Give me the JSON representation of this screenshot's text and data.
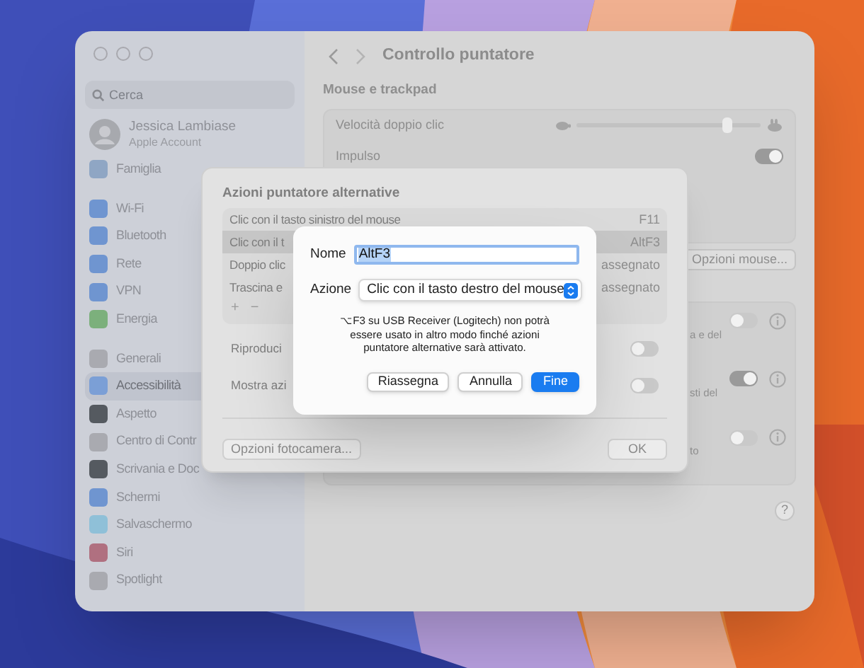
{
  "sidebar": {
    "search": {
      "placeholder": "Cerca"
    },
    "account": {
      "name": "Jessica Lambiase",
      "subtitle": "Apple Account"
    },
    "groups": [
      [
        {
          "label": "Famiglia",
          "color": "#8fa6c4",
          "selected": false
        }
      ],
      [
        {
          "label": "Wi-Fi",
          "color": "#6f95d0",
          "selected": false
        },
        {
          "label": "Bluetooth",
          "color": "#6f95d0",
          "selected": false
        },
        {
          "label": "Rete",
          "color": "#6f95d0",
          "selected": false
        },
        {
          "label": "VPN",
          "color": "#6f95d0",
          "selected": false
        },
        {
          "label": "Energia",
          "color": "#7cb07c",
          "selected": false
        }
      ],
      [
        {
          "label": "Generali",
          "color": "#a9aab0",
          "selected": false
        },
        {
          "label": "Accessibilità",
          "color": "#7b9fd6",
          "selected": true
        },
        {
          "label": "Aspetto",
          "color": "#555a60",
          "selected": false
        },
        {
          "label": "Centro di Contr",
          "color": "#a9aab0",
          "selected": false
        },
        {
          "label": "Scrivania e Doc",
          "color": "#555a60",
          "selected": false
        },
        {
          "label": "Schermi",
          "color": "#6f95d0",
          "selected": false
        },
        {
          "label": "Salvaschermo",
          "color": "#8fc0d8",
          "selected": false
        },
        {
          "label": "Siri",
          "color": "#b07080",
          "selected": false
        },
        {
          "label": "Spotlight",
          "color": "#a9aab0",
          "selected": false
        }
      ]
    ]
  },
  "main": {
    "title": "Controllo puntatore",
    "section": "Mouse e trackpad",
    "rows": [
      {
        "kind": "slider",
        "label": "Velocità doppio clic",
        "level": 0.82
      },
      {
        "kind": "toggle",
        "label": "Impulso",
        "on": true
      }
    ],
    "mouse_button": "Opzioni mouse...",
    "options": [
      {
        "text": "a e del",
        "on": false
      },
      {
        "text": "sti del",
        "on": true
      },
      {
        "text": "to",
        "on": false
      }
    ],
    "help": "?"
  },
  "sheet": {
    "title": "Azioni puntatore alternative",
    "actions": [
      {
        "action": "Clic con il tasto sinistro del mouse",
        "shortcut": "F11",
        "selected": false
      },
      {
        "action": "Clic con il t",
        "shortcut": "AltF3",
        "selected": true
      },
      {
        "action": "Doppio clic",
        "shortcut": "assegnato",
        "selected": false
      },
      {
        "action": "Trascina e",
        "shortcut": "assegnato",
        "selected": false
      }
    ],
    "add": "+",
    "remove": "−",
    "toggles": [
      {
        "label": "Riproduci",
        "on": false
      },
      {
        "label": "Mostra azi",
        "on": false
      }
    ],
    "camera_button": "Opzioni fotocamera...",
    "ok_button": "OK"
  },
  "dialog": {
    "name_label": "Nome",
    "name_value": "AltF3",
    "action_label": "Azione",
    "action_value": "Clic con il tasto destro del mouse",
    "message": "⌥F3 su USB Receiver (Logitech) non potrà essere usato in altro modo finché azioni puntatore alternative sarà attivato.",
    "buttons": [
      {
        "label": "Riassegna",
        "kind": "normal"
      },
      {
        "label": "Annulla",
        "kind": "normal"
      },
      {
        "label": "Fine",
        "kind": "default"
      }
    ]
  }
}
